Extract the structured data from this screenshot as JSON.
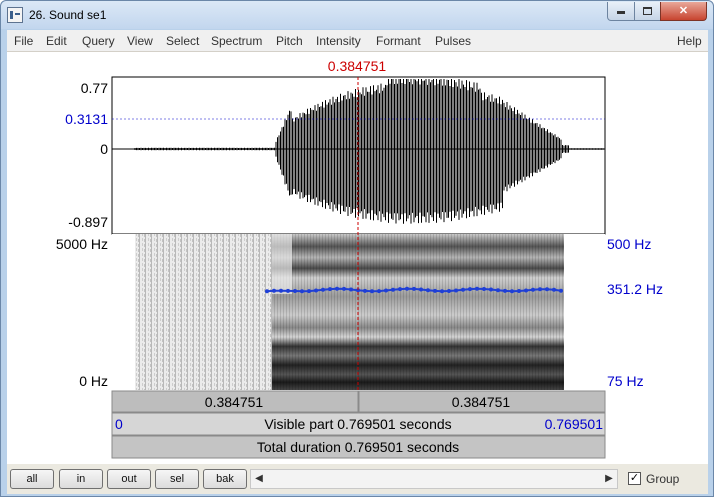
{
  "window": {
    "title": "26. Sound se1",
    "controls": {
      "minimize": "minimize-icon",
      "maximize": "maximize-icon",
      "close": "close-icon"
    }
  },
  "menu": [
    "File",
    "Edit",
    "Query",
    "View",
    "Select",
    "Spectrum",
    "Pitch",
    "Intensity",
    "Formant",
    "Pulses",
    "Help"
  ],
  "cursor_time": "0.384751",
  "waveform": {
    "top": "0.77",
    "marker": "0.3131",
    "zero": "0",
    "bottom": "-0.897"
  },
  "spectrogram": {
    "top": "5000 Hz",
    "bottom": "0 Hz"
  },
  "pitch": {
    "top": "500 Hz",
    "current": "351.2 Hz",
    "bottom": "75 Hz"
  },
  "selection_bar": {
    "left": "0.384751",
    "right": "0.384751"
  },
  "visible_bar": {
    "start": "0",
    "label": "Visible part 0.769501 seconds",
    "end": "0.769501"
  },
  "total_bar": {
    "label": "Total duration 0.769501 seconds"
  },
  "buttons": {
    "all": "all",
    "in": "in",
    "out": "out",
    "sel": "sel",
    "bak": "bak"
  },
  "group": {
    "label": "Group",
    "checked": "✓"
  },
  "colors": {
    "cursor": "#cc0000",
    "blue_label": "#0000cc",
    "pitch_line": "#1f3fd6",
    "waveform": "#000000"
  }
}
